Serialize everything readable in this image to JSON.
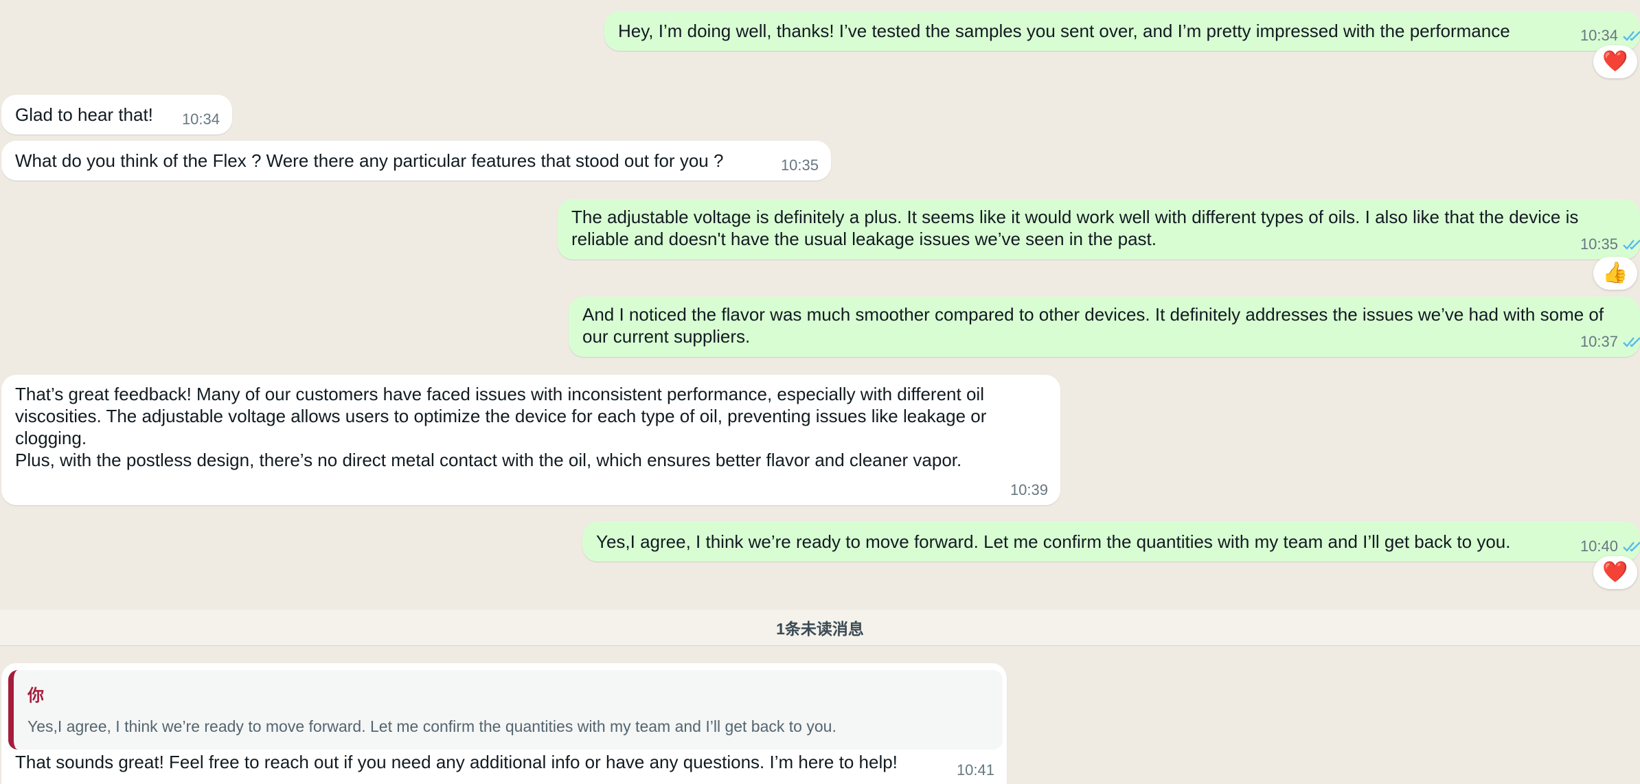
{
  "colors": {
    "incoming_bubble": "#ffffff",
    "outgoing_bubble": "#d9fdd3",
    "background": "#efeae2",
    "read_ticks": "#53bdeb",
    "quote_accent": "#a61d3c"
  },
  "messages": [
    {
      "direction": "out",
      "text": "Hey, I’m doing well, thanks! I’ve tested the samples you sent over, and I’m pretty impressed with the performance",
      "time": "10:34",
      "status_icon": "double-check-read-icon",
      "reaction": "❤️"
    },
    {
      "direction": "in",
      "text": "Glad to hear that!",
      "time": "10:34"
    },
    {
      "direction": "in",
      "text": "What do you think of the Flex ? Were there any particular features that stood out for you ?",
      "time": "10:35"
    },
    {
      "direction": "out",
      "text": "The adjustable voltage is definitely a plus. It seems like it would work well with different types of oils. I also like that the device is reliable and doesn't have the usual leakage issues we’ve seen in the past.",
      "time": "10:35",
      "status_icon": "double-check-read-icon",
      "reaction": "👍"
    },
    {
      "direction": "out",
      "text": "And I noticed the flavor was much smoother compared to other devices. It definitely addresses the issues we’ve had with some of our current suppliers.",
      "time": "10:37",
      "status_icon": "double-check-read-icon"
    },
    {
      "direction": "in",
      "text": "That’s great feedback! Many of our customers have faced issues with inconsistent performance, especially with different oil viscosities. The adjustable voltage allows users to optimize the device for each type of oil, preventing issues like leakage or clogging.\nPlus, with the postless design, there’s no direct metal contact with the oil, which ensures better flavor and cleaner vapor.",
      "time": "10:39"
    },
    {
      "direction": "out",
      "text": "Yes,I agree, I think we’re ready to move forward. Let me confirm the quantities with my team and I’ll get back to you.",
      "time": "10:40",
      "status_icon": "double-check-read-icon",
      "reaction": "❤️"
    },
    {
      "direction": "in",
      "text": "That sounds great! Feel free to reach out if you need any additional info or have any questions. I’m here to help!",
      "time": "10:41",
      "quoted": {
        "author": "你",
        "text": "Yes,I agree, I think we’re ready to move forward. Let me confirm the quantities with my team and I’ll get back to you."
      }
    }
  ],
  "unread_divider": "1条未读消息"
}
